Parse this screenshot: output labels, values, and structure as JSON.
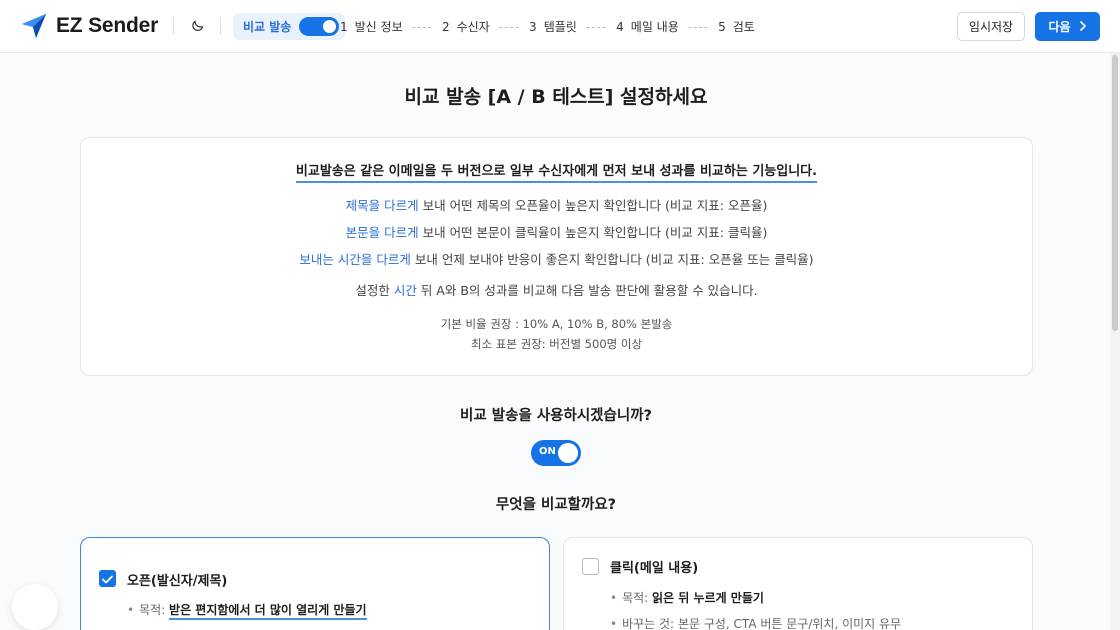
{
  "header": {
    "brand_name": "EZ Sender",
    "theme_icon": "moon-icon",
    "ab_chip_label": "비교 발송",
    "ab_chip_toggle_on": true,
    "steps": [
      {
        "num": "1",
        "label": "발신 정보"
      },
      {
        "num": "2",
        "label": "수신자"
      },
      {
        "num": "3",
        "label": "템플릿"
      },
      {
        "num": "4",
        "label": "메일 내용"
      },
      {
        "num": "5",
        "label": "검토"
      }
    ],
    "step_separator": "----",
    "save_label": "임시저장",
    "next_label": "다음"
  },
  "colors": {
    "accent": "#1673e6",
    "highlight_text": "#2a6fd6"
  },
  "main": {
    "title": "비교 발송 [A / B 테스트] 설정하세요",
    "info": {
      "lead": "비교발송은 같은 이메일을 두 버전으로 일부 수신자에게 먼저 보내 성과를 비교하는 기능입니다.",
      "lines": [
        {
          "hl": "제목을 다르게",
          "rest": " 보내 어떤 제목의 오픈율이 높은지 확인합니다 (비교 지표: 오픈율)"
        },
        {
          "hl": "본문을 다르게",
          "rest": " 보내 어떤 본문이 클릭율이 높은지 확인합니다 (비교 지표: 클릭율)"
        },
        {
          "hl": "보내는 시간을 다르게",
          "rest": " 보내 언제 보내야 반응이 좋은지 확인합니다 (비교 지표: 오픈율 또는 클릭율)"
        }
      ],
      "summary_pre": "설정한 ",
      "summary_hl": "시간",
      "summary_post": " 뒤 A와 B의 성과를 비교해 다음 발송 판단에 활용할 수 있습니다.",
      "ratio_line": "기본 비율 권장 : 10% A, 10% B, 80% 본발송",
      "sample_line": "최소 표본 권장: 버전별 500명 이상"
    },
    "use_question": "비교 발송을 사용하시겠습니까?",
    "use_toggle_label": "ON",
    "use_toggle_on": true,
    "what_question": "무엇을 비교할까요?",
    "options": [
      {
        "title": "오픈(발신자/제목)",
        "checked": true,
        "purpose_label": "목적:",
        "purpose_value": "받은 편지함에서 더 많이 열리게 만들기"
      },
      {
        "title": "클릭(메일 내용)",
        "checked": false,
        "purpose_label": "목적:",
        "purpose_value": "읽은 뒤 누르게 만들기",
        "change_label": "바꾸는 것:",
        "change_value": "본문 구성, CTA 버튼 문구/위치, 이미지 유무"
      }
    ]
  }
}
